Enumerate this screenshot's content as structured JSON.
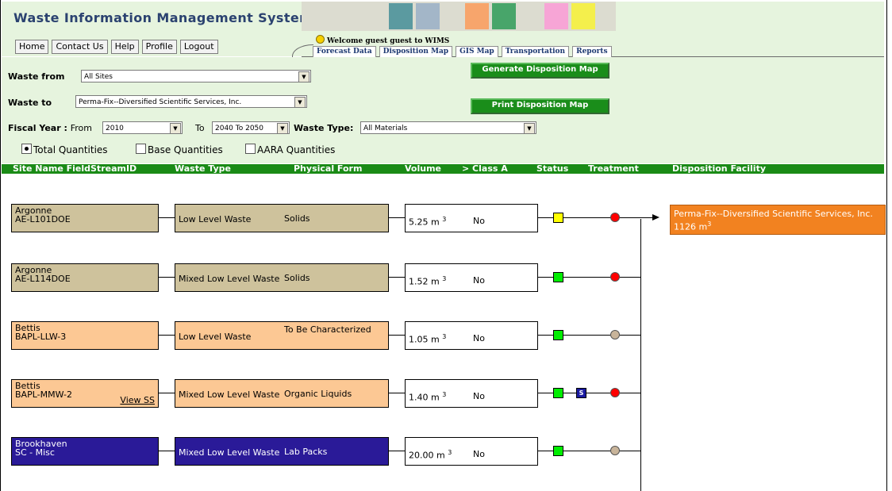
{
  "app": {
    "title": "Waste Information Management System"
  },
  "nav": {
    "home": "Home",
    "contact": "Contact Us",
    "help": "Help",
    "profile": "Profile",
    "logout": "Logout"
  },
  "welcome": "Welcome guest guest to WIMS",
  "tabs": {
    "forecast": "Forecast Data",
    "disposition": "Disposition Map",
    "gis": "GIS Map",
    "transportation": "Transportation",
    "reports": "Reports"
  },
  "filters": {
    "waste_from_label": "Waste from",
    "waste_from_value": "All Sites",
    "waste_to_label": "Waste to",
    "waste_to_value": "Perma-Fix--Diversified Scientific Services, Inc.",
    "fiscal_year_label": "Fiscal Year :",
    "from_label": "From",
    "from_value": "2010",
    "to_label": "To",
    "to_value": "2040 To 2050",
    "waste_type_label": "Waste Type:",
    "waste_type_value": "All Materials"
  },
  "buttons": {
    "generate": "Generate Disposition Map",
    "print": "Print Disposition Map"
  },
  "quantities": {
    "total": "Total Quantities",
    "base": "Base Quantities",
    "aara": "AARA Quantities",
    "selected": "total"
  },
  "table_header": {
    "site": "Site Name FieldStreamID",
    "waste_type": "Waste Type",
    "physical_form": "Physical Form",
    "volume": "Volume",
    "class_a": "> Class A",
    "status": "Status",
    "treatment": "Treatment",
    "facility": "Disposition Facility"
  },
  "rows": [
    {
      "site": "Argonne",
      "stream": "AE-L101DOE",
      "view_ss": "",
      "waste_type": "Low Level Waste",
      "form": "Solids",
      "volume": "5.25 m",
      "class_a": "No",
      "status": "yellow",
      "treatment_color": "#ff0000",
      "bg": "#cec29c",
      "dark": false
    },
    {
      "site": "Argonne",
      "stream": "AE-L114DOE",
      "view_ss": "",
      "waste_type": "Mixed Low Level Waste",
      "form": "Solids",
      "volume": "1.52 m",
      "class_a": "No",
      "status": "green",
      "treatment_color": "#ff0000",
      "bg": "#cec29c",
      "dark": false
    },
    {
      "site": "Bettis",
      "stream": "BAPL-LLW-3",
      "view_ss": "",
      "waste_type": "Low Level Waste",
      "form": "To Be Characterized",
      "volume": "1.05 m",
      "class_a": "No",
      "status": "green",
      "treatment_color": "#c8b49a",
      "bg": "#fcc894",
      "dark": false
    },
    {
      "site": "Bettis",
      "stream": "BAPL-MMW-2",
      "view_ss": "View SS",
      "waste_type": "Mixed Low Level Waste",
      "form": "Organic Liquids",
      "volume": "1.40 m",
      "class_a": "No",
      "status": "green",
      "treatment_color": "#ff0000",
      "bg": "#fcc894",
      "dark": false,
      "badge": "S"
    },
    {
      "site": "Brookhaven",
      "stream": "SC - Misc",
      "view_ss": "",
      "waste_type": "Mixed Low Level Waste",
      "form": "Lab Packs",
      "volume": "20.00 m",
      "class_a": "No",
      "status": "green",
      "treatment_color": "#c8b49a",
      "bg": "#2a1a98",
      "dark": true
    }
  ],
  "facility": {
    "name": "Perma-Fix--Diversified Scientific Services, Inc.",
    "volume": "1126 m"
  },
  "unit_sup": "3",
  "colors": {
    "header_green": "#1a8b16",
    "panel_bg": "#e6f4de",
    "facility": "#f28220"
  }
}
